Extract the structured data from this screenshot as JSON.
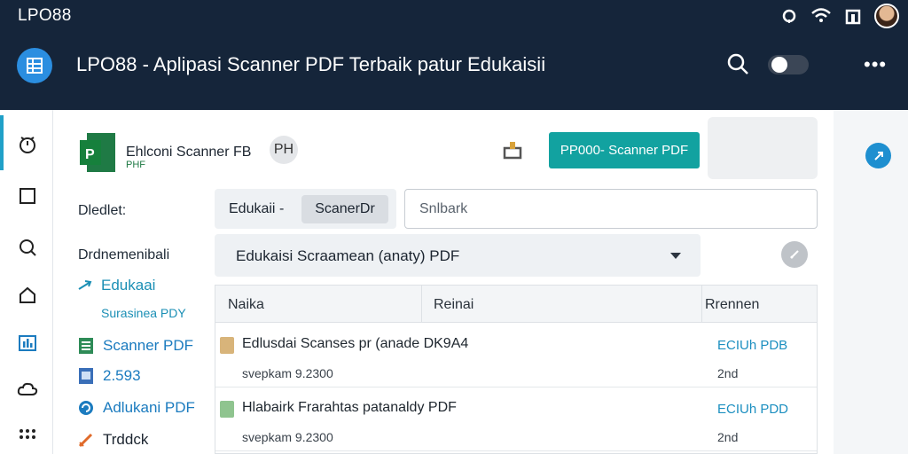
{
  "status": {
    "brand": "LPO88"
  },
  "appbar": {
    "title": "LPO88 - Aplipasi Scanner PDF Terbaik patur Edukaisii",
    "more": "•••"
  },
  "nav": {
    "heading_1": "Dledlet:",
    "heading_2": "Drdnemenibali",
    "items": [
      {
        "label": "Edukaai",
        "icon": "arrow-icon",
        "color": "#1b8fb5"
      },
      {
        "label": "Surasinea PDY",
        "icon": "",
        "color": "#1b8fb5"
      },
      {
        "label": "Scanner PDF",
        "icon": "spreadsheet-icon",
        "color": "#1b7bbf"
      },
      {
        "label": "2.593",
        "icon": "document-icon",
        "color": "#1b7bbf"
      },
      {
        "label": "Adlukani PDF",
        "icon": "refresh-icon",
        "color": "#1b7bbf"
      },
      {
        "label": "Trddck",
        "icon": "pen-icon",
        "color": "#1c2530"
      }
    ]
  },
  "document": {
    "title": "Ehlconi Scanner FB",
    "subtitle": "PHF",
    "badge": "PH"
  },
  "toolbar": {
    "primary_button": "PP000- Scanner PDF",
    "chip_1": "Edukaii",
    "chip_separator": "-",
    "chip_2": "ScanerDr",
    "search_placeholder": "Snlbark"
  },
  "filter": {
    "selected": "Edukaisi Scraamean (anaty) PDF"
  },
  "table": {
    "headers": [
      "Naika",
      "Reinai",
      "Rrennen"
    ],
    "rows": [
      {
        "name": "Edlusdai Scanses pr (anade",
        "code": "DK9A4",
        "meta": "svepkam 9.2300",
        "action": "ECIUh PDB",
        "sub": "2nd",
        "icon_color": "#d8b47a"
      },
      {
        "name": "Hlabairk Frarahtas patanaldy",
        "code": "PDF",
        "meta": "svepkam 9.2300",
        "action": "ECIUh PDD",
        "sub": "2nd",
        "icon_color": "#8fc48f"
      }
    ]
  },
  "colors": {
    "header": "#15253a",
    "accent": "#12a2a0",
    "link": "#1c8fc0"
  }
}
